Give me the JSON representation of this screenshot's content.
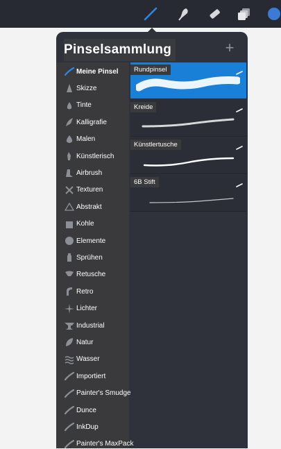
{
  "toolbar": {
    "tools": [
      {
        "name": "brush-tool",
        "icon": "brush-icon",
        "active": true
      },
      {
        "name": "smudge-tool",
        "icon": "smudge-icon",
        "active": false
      },
      {
        "name": "eraser-tool",
        "icon": "eraser-icon",
        "active": false
      },
      {
        "name": "layers-tool",
        "icon": "layers-icon",
        "active": false
      },
      {
        "name": "color-tool",
        "icon": "color-swatch-icon",
        "active": false
      }
    ],
    "active_color": "#1f78d1",
    "color_swatch": "#3a7bd5"
  },
  "panel": {
    "title": "Pinselsammlung",
    "add_label": "+"
  },
  "sets": [
    {
      "label": "Meine Pinsel",
      "icon": "brush-stroke-icon",
      "active": true
    },
    {
      "label": "Skizze",
      "icon": "pencil-icon"
    },
    {
      "label": "Tinte",
      "icon": "ink-drop-icon"
    },
    {
      "label": "Kalligrafie",
      "icon": "calligraphy-icon"
    },
    {
      "label": "Malen",
      "icon": "paint-drop-icon"
    },
    {
      "label": "Künstlerisch",
      "icon": "artistic-icon"
    },
    {
      "label": "Airbrush",
      "icon": "airbrush-icon"
    },
    {
      "label": "Texturen",
      "icon": "texture-icon"
    },
    {
      "label": "Abstrakt",
      "icon": "triangle-icon"
    },
    {
      "label": "Kohle",
      "icon": "charcoal-icon"
    },
    {
      "label": "Elemente",
      "icon": "globe-icon"
    },
    {
      "label": "Sprühen",
      "icon": "spray-can-icon"
    },
    {
      "label": "Retusche",
      "icon": "retouch-icon"
    },
    {
      "label": "Retro",
      "icon": "retro-icon"
    },
    {
      "label": "Lichter",
      "icon": "sparkle-icon"
    },
    {
      "label": "Industrial",
      "icon": "anvil-icon"
    },
    {
      "label": "Natur",
      "icon": "leaf-icon"
    },
    {
      "label": "Wasser",
      "icon": "waves-icon"
    },
    {
      "label": "Importiert",
      "icon": "brush-stroke-icon"
    },
    {
      "label": "Painter's Smudge",
      "icon": "brush-stroke-icon"
    },
    {
      "label": "Dunce",
      "icon": "brush-stroke-icon"
    },
    {
      "label": "InkDup",
      "icon": "brush-stroke-icon"
    },
    {
      "label": "Painter's MaxPack",
      "icon": "brush-stroke-icon"
    }
  ],
  "brushes": [
    {
      "name": "Rundpinsel",
      "selected": true
    },
    {
      "name": "Kreide",
      "selected": false
    },
    {
      "name": "Künstlertusche",
      "selected": false
    },
    {
      "name": "6B Stift",
      "selected": false
    }
  ]
}
